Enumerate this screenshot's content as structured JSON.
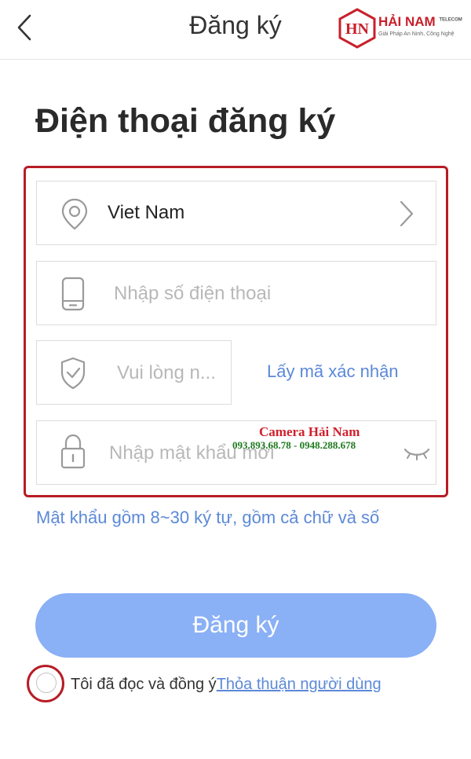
{
  "header": {
    "title": "Đăng ký",
    "logo_text": "HẢI NAM",
    "logo_suffix": "TELECOM",
    "logo_tagline": "Giải Pháp An Ninh, Công Nghệ",
    "logo_mark": "HN"
  },
  "page": {
    "title": "Điện thoại đăng ký"
  },
  "form": {
    "country_value": "Viet Nam",
    "phone_placeholder": "Nhập số điện thoại",
    "code_placeholder": "Vui lòng n...",
    "get_code_label": "Lấy mã xác nhận",
    "password_placeholder": "Nhập mật khẩu mới",
    "password_hint": "Mật khẩu gồm 8~30 ký tự, gồm cả chữ và số",
    "submit_label": "Đăng ký"
  },
  "agreement": {
    "text": "Tôi đã đọc và đồng ý",
    "link": "Thỏa thuận người dùng"
  },
  "watermark": {
    "line1": "Camera Hải Nam",
    "line2": "093.893.68.78 - 0948.288.678"
  },
  "colors": {
    "accent": "#5b89d8",
    "button": "#8ab0f5",
    "highlight": "#b71c25"
  }
}
